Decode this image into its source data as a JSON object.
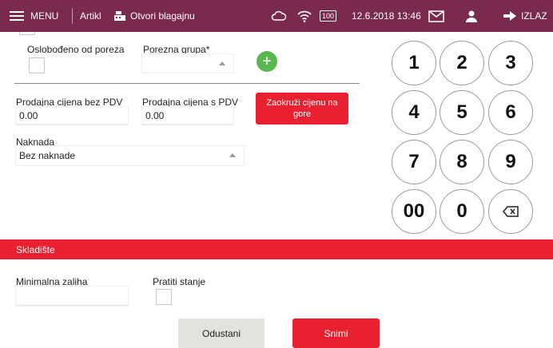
{
  "topbar": {
    "menu_label": "MENU",
    "artikl_label": "Artikl",
    "register_label": "Otvori blagajnu",
    "battery": "100",
    "datetime": "12.6.2018 13:46",
    "exit_label": "IZLAZ",
    "color": "#7a2a4d"
  },
  "form": {
    "tax_exempt_label": "Oslobođeno od poreza",
    "tax_group_label": "Porezna grupa*",
    "tax_group_value": "",
    "price_no_vat_label": "Prodajna cijena bez PDV",
    "price_no_vat_value": "0.00",
    "price_vat_label": "Prodajna cijena s PDV",
    "price_vat_value": "0.00",
    "round_button_label": "Zaokruži cijenu na gore",
    "fee_label": "Naknada",
    "fee_value": "Bez naknade"
  },
  "keypad": {
    "keys": [
      "1",
      "2",
      "3",
      "4",
      "5",
      "6",
      "7",
      "8",
      "9",
      "00",
      "0"
    ],
    "backspace_icon": "backspace-icon"
  },
  "warehouse": {
    "section_title": "Skladište",
    "min_stock_label": "Minimalna zaliha",
    "min_stock_value": "",
    "track_stock_label": "Pratiti stanje"
  },
  "actions": {
    "cancel_label": "Odustani",
    "save_label": "Snimi"
  },
  "colors": {
    "accent_red": "#e8202f",
    "add_green": "#58b84f"
  }
}
